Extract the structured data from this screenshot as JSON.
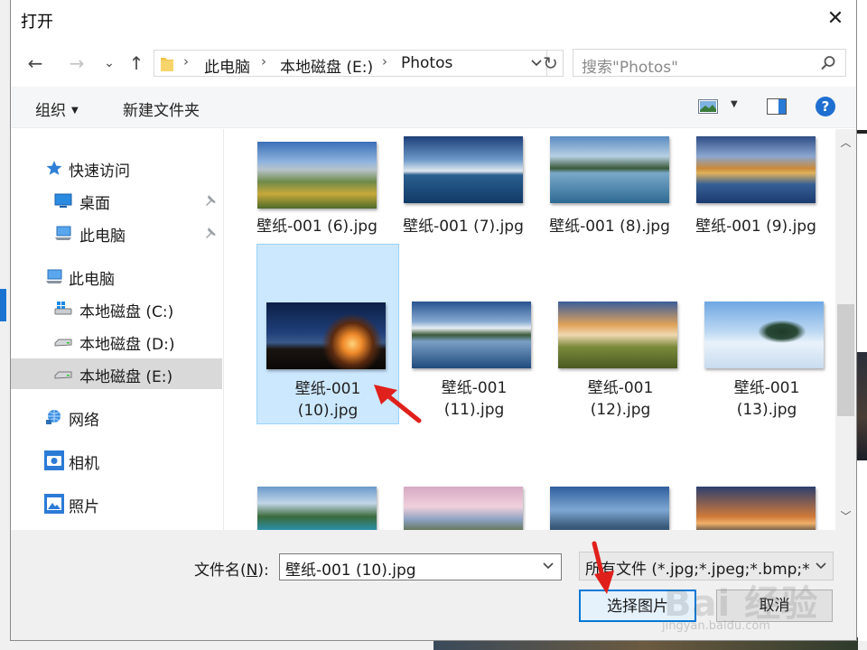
{
  "window": {
    "title": "打开",
    "close_glyph": "✕"
  },
  "nav": {
    "back": "←",
    "forward": "→",
    "recent": "⌄",
    "up": "↑",
    "refresh": "↻"
  },
  "address": {
    "segments": [
      "此电脑",
      "本地磁盘 (E:)",
      "Photos"
    ],
    "separator": "›"
  },
  "search": {
    "placeholder": "搜索\"Photos\""
  },
  "toolbar": {
    "organize": "组织",
    "new_folder": "新建文件夹",
    "help": "?"
  },
  "sidebar": {
    "items": [
      {
        "label": "快速访问",
        "icon": "star-icon"
      },
      {
        "label": "桌面",
        "icon": "desktop-icon",
        "pinned": true
      },
      {
        "label": "此电脑",
        "icon": "computer-icon",
        "pinned": true
      },
      {
        "label": "此电脑",
        "icon": "computer-icon"
      },
      {
        "label": "本地磁盘 (C:)",
        "icon": "windows-drive-icon"
      },
      {
        "label": "本地磁盘 (D:)",
        "icon": "drive-icon"
      },
      {
        "label": "本地磁盘 (E:)",
        "icon": "drive-icon",
        "selected": true
      },
      {
        "label": "网络",
        "icon": "network-icon"
      },
      {
        "label": "相机",
        "icon": "camera-icon"
      },
      {
        "label": "照片",
        "icon": "photos-icon"
      }
    ]
  },
  "files": {
    "row1": [
      {
        "name": "壁纸-001 (6).jpg"
      },
      {
        "name": "壁纸-001 (7).jpg"
      },
      {
        "name": "壁纸-001 (8).jpg"
      },
      {
        "name": "壁纸-001 (9).jpg"
      }
    ],
    "row2": [
      {
        "line1": "壁纸-001",
        "line2": "(10).jpg",
        "selected": true
      },
      {
        "line1": "壁纸-001",
        "line2": "(11).jpg"
      },
      {
        "line1": "壁纸-001",
        "line2": "(12).jpg"
      },
      {
        "line1": "壁纸-001",
        "line2": "(13).jpg"
      }
    ]
  },
  "footer": {
    "filename_label": "文件名(",
    "filename_accel": "N",
    "filename_label_end": "):",
    "filename_value": "壁纸-001 (10).jpg",
    "filetype_value": "所有文件 (*.jpg;*.jpeg;*.bmp;*",
    "open_button": "选择图片",
    "cancel_button": "取消"
  },
  "watermark": {
    "main": "Bai 经验",
    "sub": "jingyan.baidu.com"
  },
  "colors": {
    "accent": "#0078d7",
    "selection": "#cce8ff",
    "arrow": "#e0201b"
  }
}
